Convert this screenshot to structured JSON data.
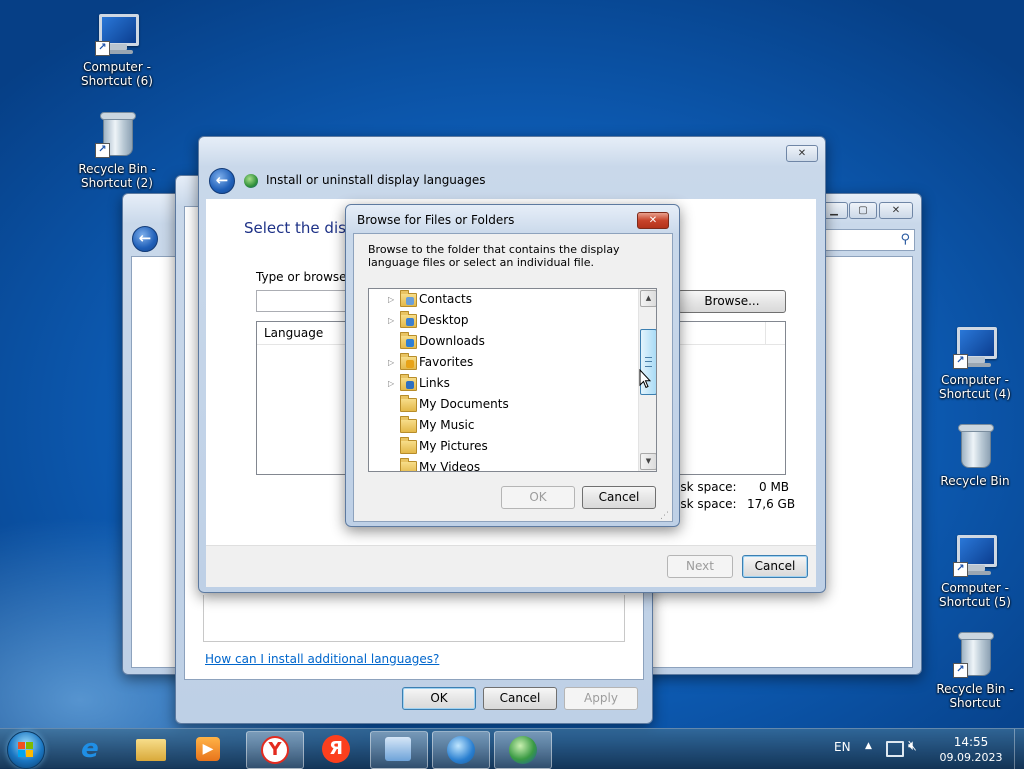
{
  "desktop": {
    "icons": [
      {
        "label": "Computer - Shortcut (6)"
      },
      {
        "label": "Recycle Bin - Shortcut (2)"
      },
      {
        "label": "Computer - Shortcut (4)"
      },
      {
        "label": "Recycle Bin"
      },
      {
        "label": "Computer - Shortcut (5)"
      },
      {
        "label": "Recycle Bin - Shortcut"
      }
    ]
  },
  "install_wizard": {
    "title": "Install or uninstall display languages",
    "heading": "Select the disp",
    "type_or_browse_label": "Type or browse t",
    "path_value": "",
    "browse_button": "Browse...",
    "column_language": "Language",
    "disk_space_required_label": "isk space:",
    "disk_space_required_value": "0 MB",
    "disk_space_available_label": "isk space:",
    "disk_space_available_value": "17,6 GB",
    "next_button": "Next",
    "cancel_button": "Cancel"
  },
  "region_dialog": {
    "help_link": "How can I install additional languages?",
    "ok_button": "OK",
    "cancel_button": "Cancel",
    "apply_button": "Apply"
  },
  "browse_dialog": {
    "title": "Browse for Files or Folders",
    "description": "Browse to the folder that contains the display language files or select an individual file.",
    "items": [
      {
        "label": "Contacts",
        "expandable": true
      },
      {
        "label": "Desktop",
        "expandable": true
      },
      {
        "label": "Downloads",
        "expandable": false
      },
      {
        "label": "Favorites",
        "expandable": true
      },
      {
        "label": "Links",
        "expandable": true
      },
      {
        "label": "My Documents",
        "expandable": false
      },
      {
        "label": "My Music",
        "expandable": false
      },
      {
        "label": "My Pictures",
        "expandable": false
      },
      {
        "label": "My Videos",
        "expandable": false
      }
    ],
    "ok_button": "OK",
    "cancel_button": "Cancel"
  },
  "taskbar": {
    "language": "EN",
    "time": "14:55",
    "date": "09.09.2023",
    "apps": [
      "internet-explorer-icon",
      "file-explorer-icon",
      "media-player-icon",
      "yandex-browser-icon",
      "yandex-icon",
      "control-panel-icon",
      "network-globe-icon",
      "region-language-icon"
    ]
  },
  "colors": {
    "desktop_blue": "#0d5bb3",
    "accent_blue": "#1f5fb8",
    "close_red": "#c7432a"
  }
}
